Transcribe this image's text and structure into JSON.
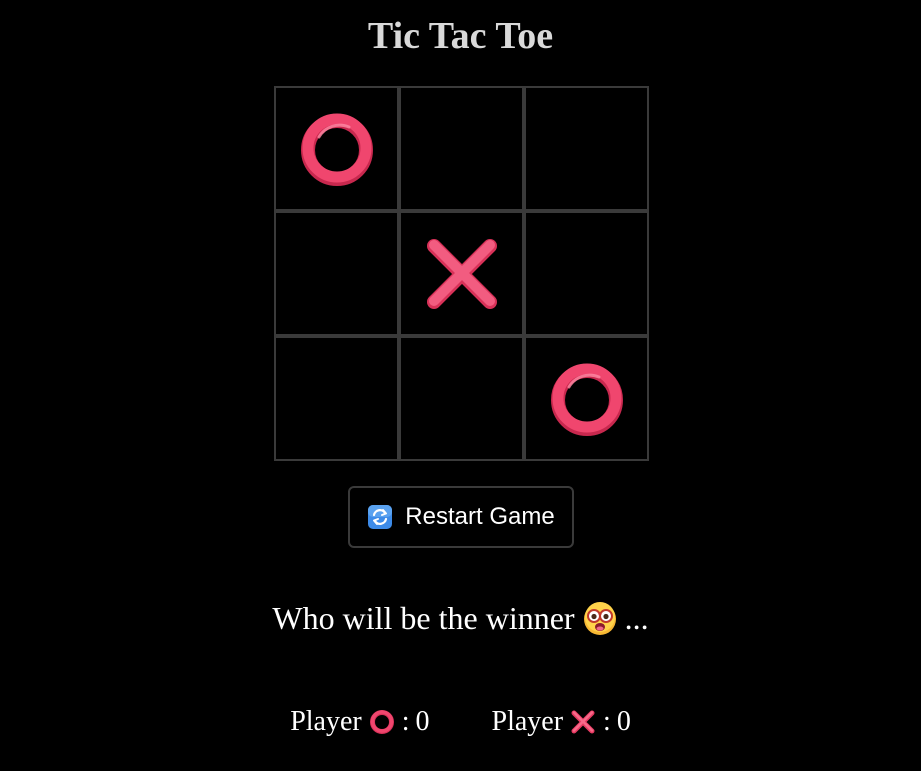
{
  "title": "Tic Tac Toe",
  "board": [
    "O",
    "",
    "",
    "",
    "X",
    "",
    "",
    "",
    "O"
  ],
  "restart_button": {
    "icon": "refresh-icon",
    "label": "Restart Game"
  },
  "status": {
    "prefix": "Who will be the winner",
    "emoji": "face-with-glasses-icon",
    "suffix": "..."
  },
  "scores": [
    {
      "label": "Player",
      "mark": "O",
      "separator": ":",
      "value": "0"
    },
    {
      "label": "Player",
      "mark": "X",
      "separator": ":",
      "value": "0"
    }
  ],
  "colors": {
    "background": "#000000",
    "title": "#d9d9d9",
    "grid_line": "#3a3a3a",
    "mark_pink": "#f0466e",
    "refresh_blue": "#3d8be8"
  }
}
